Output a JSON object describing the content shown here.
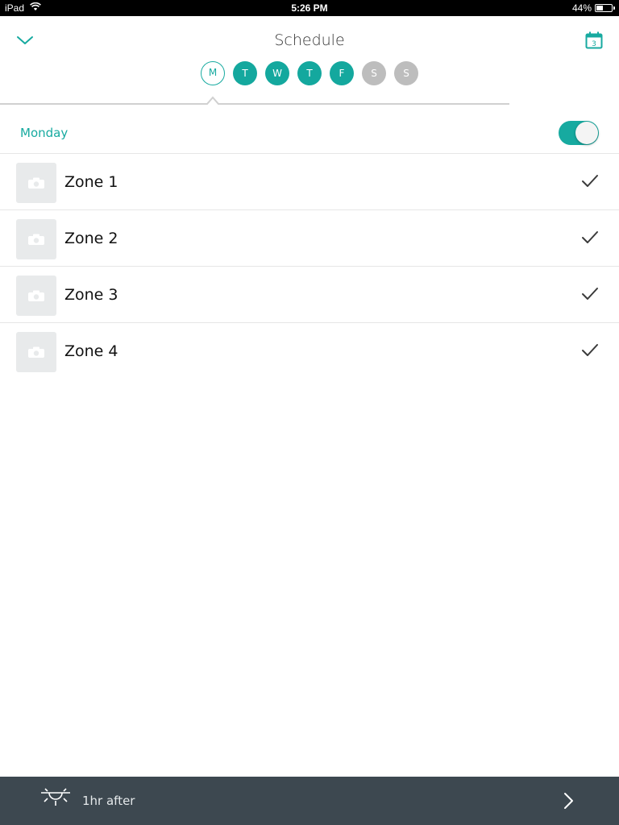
{
  "status_bar": {
    "carrier": "iPad",
    "time": "5:26 PM",
    "battery": "44%",
    "battery_level": 0.44
  },
  "header": {
    "title": "Schedule",
    "calendar_day": "3"
  },
  "days": [
    {
      "label": "M",
      "state": "selected"
    },
    {
      "label": "T",
      "state": "on"
    },
    {
      "label": "W",
      "state": "on"
    },
    {
      "label": "T",
      "state": "on"
    },
    {
      "label": "F",
      "state": "on"
    },
    {
      "label": "S",
      "state": "off"
    },
    {
      "label": "S",
      "state": "off"
    }
  ],
  "section": {
    "label": "Monday",
    "enabled": true
  },
  "zones": [
    {
      "name": "Zone 1",
      "checked": true
    },
    {
      "name": "Zone 2",
      "checked": true
    },
    {
      "name": "Zone 3",
      "checked": true
    },
    {
      "name": "Zone 4",
      "checked": true
    }
  ],
  "footer": {
    "text": "1hr after",
    "icon": "sunrise-icon"
  },
  "colors": {
    "accent": "#17aaa0",
    "day_off": "#bdbdbd",
    "footer_bg": "#3d4850"
  }
}
